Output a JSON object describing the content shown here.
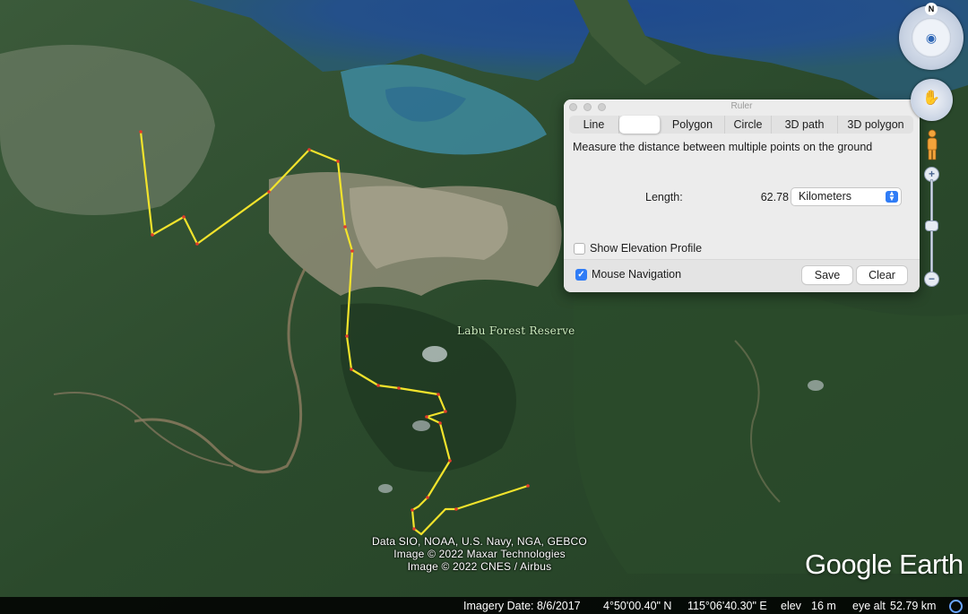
{
  "colors": {
    "measure_line": "#f2e32c",
    "measure_point": "#e33b2b",
    "accent": "#2f7cf6"
  },
  "ruler": {
    "window_title": "Ruler",
    "tabs": [
      {
        "label": "Line"
      },
      {
        "label": ""
      },
      {
        "label": "Polygon"
      },
      {
        "label": "Circle"
      },
      {
        "label": "3D path"
      },
      {
        "label": "3D polygon"
      }
    ],
    "active_tab_index": 1,
    "instruction": "Measure the distance between multiple points on the ground",
    "length_label": "Length:",
    "length_value": "62.78",
    "unit_selected": "Kilometers",
    "show_elevation_profile": {
      "label": "Show Elevation Profile",
      "checked": false
    },
    "mouse_navigation": {
      "label": "Mouse Navigation",
      "checked": true
    },
    "save_label": "Save",
    "clear_label": "Clear"
  },
  "map": {
    "place_label": "Labu Forest Reserve",
    "attribution": [
      "Data SIO, NOAA, U.S. Navy, NGA, GEBCO",
      "Image © 2022 Maxar Technologies",
      "Image © 2022 CNES / Airbus"
    ],
    "logo": "Google Earth"
  },
  "status_bar": {
    "imagery_date": "Imagery Date: 8/6/2017",
    "latitude": "4°50'00.40\" N",
    "longitude": "115°06'40.30\" E",
    "elev_label": "elev",
    "elev_value": "16 m",
    "eye_alt_label": "eye alt",
    "eye_alt_value": "52.79 km"
  },
  "nav": {
    "compass_north": "N",
    "compass_icon": "eye-icon",
    "pan_icon": "hand-icon",
    "pegman_icon": "pegman-icon",
    "zoom_in_icon": "plus-icon",
    "zoom_out_icon": "minus-icon"
  }
}
